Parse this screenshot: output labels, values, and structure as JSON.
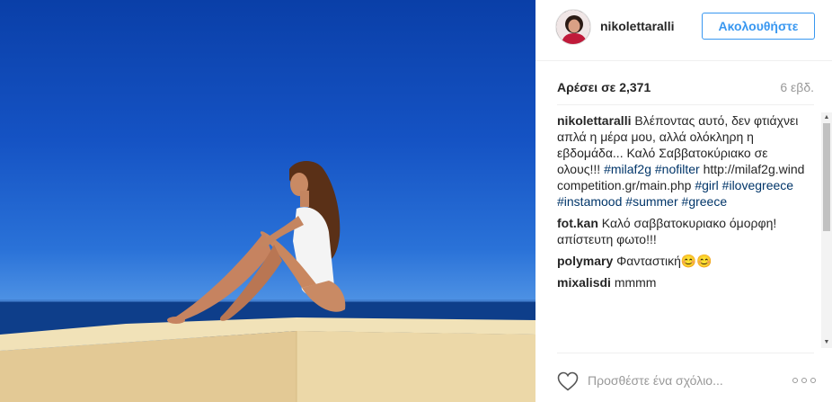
{
  "post": {
    "username": "nikolettaralli",
    "follow_label": "Ακολουθήστε",
    "likes": "Αρέσει σε 2,371",
    "time_ago": "6 εβδ."
  },
  "comments": {
    "caption": {
      "user": "nikolettaralli",
      "text": "Βλέποντας αυτό, δεν φτιάχνει απλά η μέρα μου, αλλά ολόκληρη η εβδομάδα... Καλό Σαββατοκύριακο σε ολους!!!",
      "tag1": "#milaf2g",
      "tag2": "#nofilter",
      "url": "http://milaf2g.windcompetition.gr/main.php",
      "tag3": "#girl",
      "tag4": "#ilovegreece",
      "tag5": "#instamood",
      "tag6": "#summer",
      "tag7": "#greece"
    },
    "c1": {
      "user": "fot.kan",
      "text": "Καλό σαββατοκυριακο όμορφη! απίστευτη φωτο!!!"
    },
    "c2": {
      "user": "polymary",
      "text": "Φανταστική😊😊"
    },
    "c3": {
      "user": "mixalisdi",
      "text": "mmmm"
    }
  },
  "footer": {
    "comment_placeholder": "Προσθέστε ένα σχόλιο..."
  },
  "icons": {
    "heart": "heart-outline-icon",
    "more": "more-options-icon",
    "scroll_up": "arrow-up-icon",
    "scroll_down": "arrow-down-icon"
  },
  "colors": {
    "accent": "#3897f0",
    "hashtag": "#003569",
    "muted": "#999999",
    "sky": "#1553c4",
    "sea": "#0e3e8a",
    "wall": "#eedcae"
  }
}
